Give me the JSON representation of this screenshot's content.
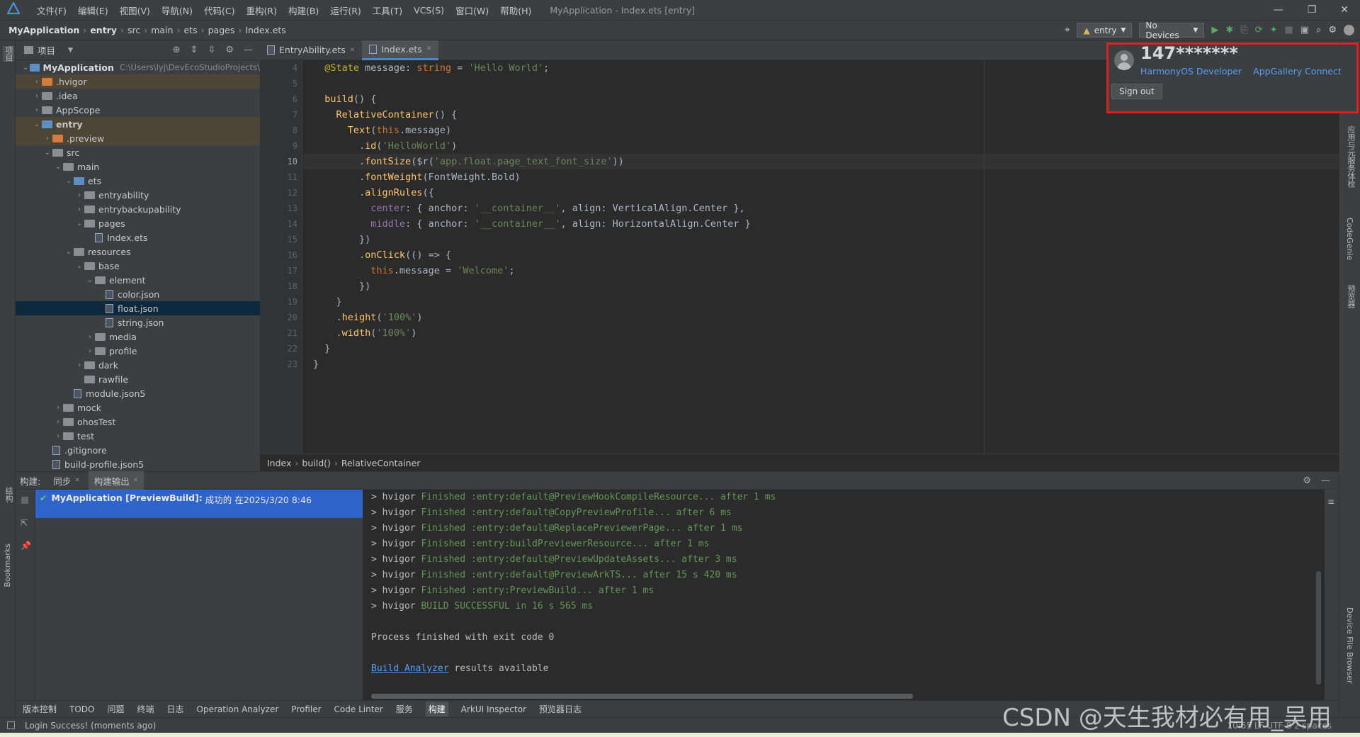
{
  "titlebar": {
    "menus": [
      "文件(F)",
      "编辑(E)",
      "视图(V)",
      "导航(N)",
      "代码(C)",
      "重构(R)",
      "构建(B)",
      "运行(R)",
      "工具(T)",
      "VCS(S)",
      "窗口(W)",
      "帮助(H)"
    ],
    "title": "MyApplication - Index.ets [entry]"
  },
  "navbar": {
    "breadcrumb": [
      "MyApplication",
      "entry",
      "src",
      "main",
      "ets",
      "pages",
      "Index.ets"
    ],
    "run_config": "entry",
    "device": "No Devices"
  },
  "project_panel": {
    "header": "项目",
    "root_name": "MyApplication",
    "root_path": "C:\\Users\\lyj\\DevEcoStudioProjects\\",
    "items": [
      {
        "label": ".hvigor",
        "depth": 1,
        "arrow": "›",
        "kind": "orange"
      },
      {
        "label": ".idea",
        "depth": 1,
        "arrow": "›",
        "kind": "folder"
      },
      {
        "label": "AppScope",
        "depth": 1,
        "arrow": "›",
        "kind": "folder"
      },
      {
        "label": "entry",
        "depth": 1,
        "arrow": "⌄",
        "kind": "blue"
      },
      {
        "label": ".preview",
        "depth": 2,
        "arrow": "›",
        "kind": "orange"
      },
      {
        "label": "src",
        "depth": 2,
        "arrow": "⌄",
        "kind": "folder"
      },
      {
        "label": "main",
        "depth": 3,
        "arrow": "⌄",
        "kind": "folder"
      },
      {
        "label": "ets",
        "depth": 4,
        "arrow": "⌄",
        "kind": "blue"
      },
      {
        "label": "entryability",
        "depth": 5,
        "arrow": "›",
        "kind": "folder"
      },
      {
        "label": "entrybackupability",
        "depth": 5,
        "arrow": "›",
        "kind": "folder"
      },
      {
        "label": "pages",
        "depth": 5,
        "arrow": "⌄",
        "kind": "folder"
      },
      {
        "label": "Index.ets",
        "depth": 6,
        "arrow": "",
        "kind": "file"
      },
      {
        "label": "resources",
        "depth": 4,
        "arrow": "⌄",
        "kind": "folder"
      },
      {
        "label": "base",
        "depth": 5,
        "arrow": "⌄",
        "kind": "folder"
      },
      {
        "label": "element",
        "depth": 6,
        "arrow": "⌄",
        "kind": "folder"
      },
      {
        "label": "color.json",
        "depth": 7,
        "arrow": "",
        "kind": "file"
      },
      {
        "label": "float.json",
        "depth": 7,
        "arrow": "",
        "kind": "file"
      },
      {
        "label": "string.json",
        "depth": 7,
        "arrow": "",
        "kind": "file"
      },
      {
        "label": "media",
        "depth": 6,
        "arrow": "›",
        "kind": "folder"
      },
      {
        "label": "profile",
        "depth": 6,
        "arrow": "›",
        "kind": "folder"
      },
      {
        "label": "dark",
        "depth": 5,
        "arrow": "›",
        "kind": "folder"
      },
      {
        "label": "rawfile",
        "depth": 5,
        "arrow": "",
        "kind": "folder"
      },
      {
        "label": "module.json5",
        "depth": 4,
        "arrow": "",
        "kind": "file"
      },
      {
        "label": "mock",
        "depth": 3,
        "arrow": "›",
        "kind": "folder"
      },
      {
        "label": "ohosTest",
        "depth": 3,
        "arrow": "›",
        "kind": "folder"
      },
      {
        "label": "test",
        "depth": 3,
        "arrow": "›",
        "kind": "folder"
      },
      {
        "label": ".gitignore",
        "depth": 2,
        "arrow": "",
        "kind": "file"
      },
      {
        "label": "build-profile.json5",
        "depth": 2,
        "arrow": "",
        "kind": "file"
      }
    ]
  },
  "editor": {
    "tabs": [
      {
        "label": "EntryAbility.ets"
      },
      {
        "label": "Index.ets"
      }
    ],
    "line_numbers": [
      "4",
      "5",
      "6",
      "7",
      "8",
      "9",
      "10",
      "11",
      "12",
      "13",
      "14",
      "15",
      "16",
      "17",
      "18",
      "19",
      "20",
      "21",
      "22",
      "23"
    ],
    "lines": [
      "  @State message: string = 'Hello World';",
      "",
      "  build() {",
      "    RelativeContainer() {",
      "      Text(this.message)",
      "        .id('HelloWorld')",
      "        .fontSize($r('app.float.page_text_font_size'))",
      "        .fontWeight(FontWeight.Bold)",
      "        .alignRules({",
      "          center: { anchor: '__container__', align: VerticalAlign.Center },",
      "          middle: { anchor: '__container__', align: HorizontalAlign.Center }",
      "        })",
      "        .onClick(() => {",
      "          this.message = 'Welcome';",
      "        })",
      "    }",
      "    .height('100%')",
      "    .width('100%')",
      "  }",
      "}"
    ],
    "breadcrumb": [
      "Index",
      "build()",
      "RelativeContainer"
    ]
  },
  "build_panel": {
    "label": "构建:",
    "tabs": [
      "同步",
      "构建输出"
    ],
    "result_title": "MyApplication [PreviewBuild]:",
    "result_status": "成功的 在2025/3/20 8:46",
    "output": [
      {
        "prefix": "> hvigor ",
        "text": "Finished :entry:default@PreviewHookCompileResource... after 1 ms"
      },
      {
        "prefix": "> hvigor ",
        "text": "Finished :entry:default@CopyPreviewProfile... after 6 ms"
      },
      {
        "prefix": "> hvigor ",
        "text": "Finished :entry:default@ReplacePreviewerPage... after 1 ms"
      },
      {
        "prefix": "> hvigor ",
        "text": "Finished :entry:buildPreviewerResource... after 1 ms"
      },
      {
        "prefix": "> hvigor ",
        "text": "Finished :entry:default@PreviewUpdateAssets... after 3 ms"
      },
      {
        "prefix": "> hvigor ",
        "text": "Finished :entry:default@PreviewArkTS... after 15 s 420 ms"
      },
      {
        "prefix": "> hvigor ",
        "text": "Finished :entry:PreviewBuild... after 1 ms"
      },
      {
        "prefix": "> hvigor ",
        "text": "BUILD SUCCESSFUL in 16 s 565 ms"
      }
    ],
    "exit_line": "Process finished with exit code 0",
    "analyzer_link": "Build Analyzer",
    "analyzer_suffix": " results available"
  },
  "tool_windows": [
    "版本控制",
    "TODO",
    "问题",
    "终端",
    "日志",
    "Operation Analyzer",
    "Profiler",
    "Code Linter",
    "服务",
    "构建",
    "ArkUI Inspector",
    "预览器日志"
  ],
  "left_strip": {
    "top": "项目",
    "structure": "结构",
    "bookmarks": "Bookmarks"
  },
  "right_strip": [
    "应用与元服务体检",
    "CodeGenie",
    "预览器",
    "Device File Browser"
  ],
  "status": {
    "message": "Login Success! (moments ago)",
    "right": "10:55  LF  UTF-8  2 spaces"
  },
  "account_popup": {
    "username": "147*******",
    "link1": "HarmonyOS Developer",
    "link2": "AppGallery Connect",
    "signout": "Sign out"
  },
  "watermark": "CSDN @天生我材必有用_吴用",
  "colors": {
    "accent": "#4a88c7",
    "highlight_border": "#e02020",
    "success": "#629755"
  }
}
